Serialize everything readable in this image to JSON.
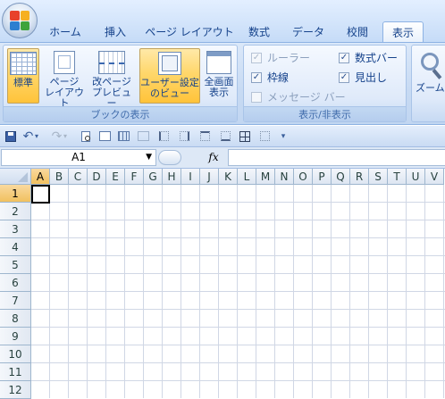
{
  "colors": {
    "accent": "#15428b",
    "ribbon": "#c7daf3",
    "selected": "#ffd76b",
    "gridline": "#d0d7e5"
  },
  "office_button": {
    "icon": "office-logo-icon"
  },
  "tabs": [
    {
      "label": "ホーム"
    },
    {
      "label": "挿入"
    },
    {
      "label": "ページ レイアウト"
    },
    {
      "label": "数式"
    },
    {
      "label": "データ"
    },
    {
      "label": "校閲"
    },
    {
      "label": "表示",
      "active": true
    }
  ],
  "ribbon": {
    "book_views": {
      "label": "ブックの表示",
      "buttons": [
        {
          "line1": "標準",
          "line2": "",
          "icon": "normal-view-icon",
          "selected": true
        },
        {
          "line1": "ページ",
          "line2": "レイアウト",
          "icon": "page-layout-icon"
        },
        {
          "line1": "改ページ",
          "line2": "プレビュー",
          "icon": "page-break-preview-icon"
        },
        {
          "line1": "ユーザー設定",
          "line2": "のビュー",
          "icon": "custom-views-icon",
          "selected": true
        },
        {
          "line1": "全画面",
          "line2": "表示",
          "icon": "full-screen-icon"
        }
      ]
    },
    "show_hide": {
      "label": "表示/非表示",
      "checks": [
        {
          "label": "ルーラー",
          "checked": true,
          "disabled": true
        },
        {
          "label": "数式バー",
          "checked": true,
          "disabled": false
        },
        {
          "label": "枠線",
          "checked": true,
          "disabled": false
        },
        {
          "label": "見出し",
          "checked": true,
          "disabled": false
        },
        {
          "label": "メッセージ バー",
          "checked": false,
          "disabled": true
        }
      ]
    },
    "zoom": {
      "label": "ズーム",
      "icon": "zoom-magnifier-icon"
    }
  },
  "qat": {
    "items": [
      "save-icon",
      "undo-icon",
      "redo-icon",
      "print-preview-icon",
      "normal-view-icon",
      "page-break-icon",
      "table-icon",
      "border-icon",
      "border-icon",
      "border-icon",
      "border-icon",
      "border-icon",
      "all-borders-icon",
      "border-icon",
      "customize-qat-icon"
    ]
  },
  "formula_bar": {
    "name_box": "A1",
    "fx": "fx",
    "value": ""
  },
  "sheet": {
    "columns": [
      "A",
      "B",
      "C",
      "D",
      "E",
      "F",
      "G",
      "H",
      "I",
      "J",
      "K",
      "L",
      "M",
      "N",
      "O",
      "P",
      "Q",
      "R",
      "S",
      "T",
      "U",
      "V"
    ],
    "rows": [
      "1",
      "2",
      "3",
      "4",
      "5",
      "6",
      "7",
      "8",
      "9",
      "10",
      "11",
      "12"
    ],
    "active_cell": "A1"
  }
}
